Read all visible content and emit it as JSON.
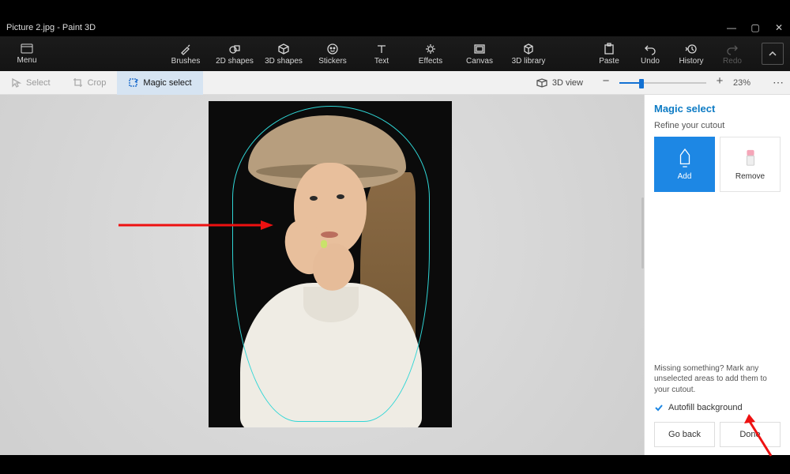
{
  "title": "Picture 2.jpg - Paint 3D",
  "menu_label": "Menu",
  "ribbon_tools": {
    "brushes": "Brushes",
    "shapes2d": "2D shapes",
    "shapes3d": "3D shapes",
    "stickers": "Stickers",
    "text": "Text",
    "effects": "Effects",
    "canvas": "Canvas",
    "library3d": "3D library"
  },
  "ribbon_right": {
    "paste": "Paste",
    "undo": "Undo",
    "history": "History",
    "redo": "Redo"
  },
  "subbar": {
    "select": "Select",
    "crop": "Crop",
    "magic": "Magic select",
    "view3d": "3D view",
    "zoom_pct": "23%"
  },
  "panel": {
    "title": "Magic select",
    "subtitle": "Refine your cutout",
    "add": "Add",
    "remove": "Remove",
    "help": "Missing something? Mark any unselected areas to add them to your cutout.",
    "autofill": "Autofill background",
    "go_back": "Go back",
    "done": "Done"
  }
}
